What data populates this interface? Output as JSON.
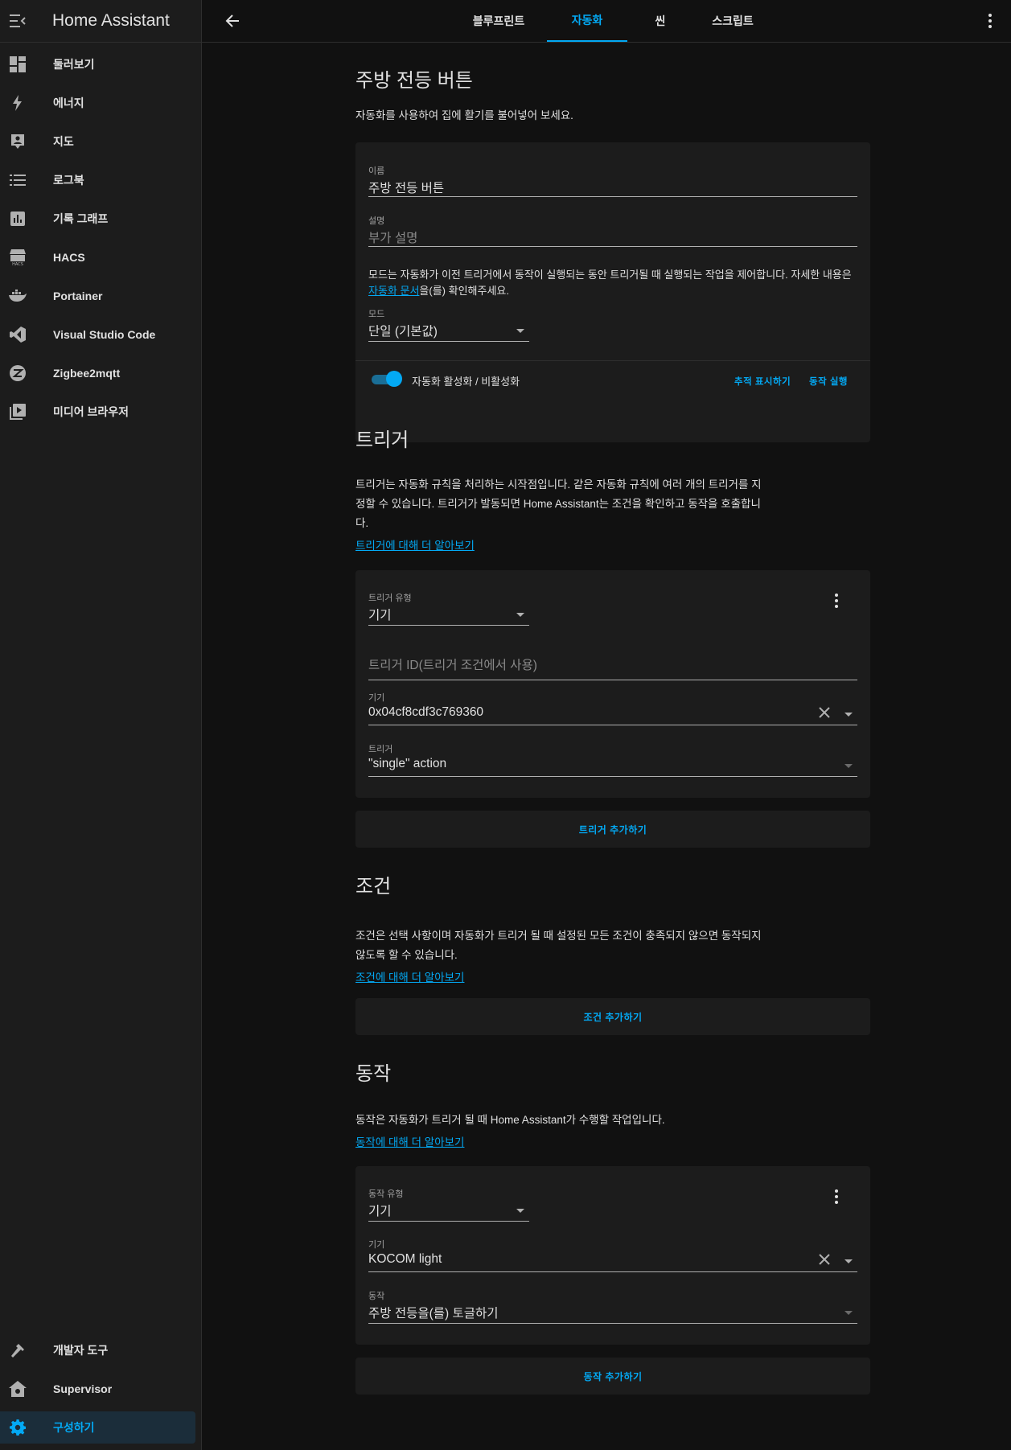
{
  "app": {
    "title": "Home Assistant"
  },
  "sidebar": {
    "items": [
      {
        "label": "둘러보기",
        "icon": "dashboard-icon"
      },
      {
        "label": "에너지",
        "icon": "lightning-icon"
      },
      {
        "label": "지도",
        "icon": "map-person-icon"
      },
      {
        "label": "로그북",
        "icon": "list-icon"
      },
      {
        "label": "기록 그래프",
        "icon": "chart-icon"
      },
      {
        "label": "HACS",
        "icon": "hacs-icon"
      },
      {
        "label": "Portainer",
        "icon": "docker-icon"
      },
      {
        "label": "Visual Studio Code",
        "icon": "vscode-icon"
      },
      {
        "label": "Zigbee2mqtt",
        "icon": "zigbee-icon"
      },
      {
        "label": "미디어 브라우저",
        "icon": "media-icon"
      }
    ],
    "bottom": [
      {
        "label": "개발자 도구",
        "icon": "hammer-icon"
      },
      {
        "label": "Supervisor",
        "icon": "supervisor-home-icon"
      },
      {
        "label": "구성하기",
        "icon": "gear-icon",
        "active": true
      }
    ]
  },
  "tabs": [
    {
      "label": "블루프린트"
    },
    {
      "label": "자동화",
      "active": true
    },
    {
      "label": "씬"
    },
    {
      "label": "스크립트"
    }
  ],
  "automation": {
    "heading": "주방 전등 버튼",
    "intro": "자동화를 사용하여 집에 활기를 불어넣어 보세요.",
    "name_label": "이름",
    "name_value": "주방 전등 버튼",
    "desc_label": "설명",
    "desc_placeholder": "부가 설명",
    "mode_help_1": "모드는 자동화가 이전 트리거에서 동작이 실행되는 동안 트리거될 때 실행되는 작업을 제어합니다. 자세한 내용은",
    "mode_help_link": "자동화 문서",
    "mode_help_2": "을(를) 확인해주세요.",
    "mode_label": "모드",
    "mode_value": "단일 (기본값)",
    "toggle_label": "자동화 활성화 / 비활성화",
    "toggle_on": true,
    "trace_button": "추적 표시하기",
    "run_button": "동작 실행"
  },
  "triggers": {
    "heading": "트리거",
    "desc_1": "트리거는 자동화 규칙을 처리하는 시작점입니다. 같은 자동화 규칙에 여러 개의 트리거를 지",
    "desc_2": "정할 수 있습니다. 트리거가 발동되면 Home Assistant는 조건을 확인하고 동작을 호출합니",
    "desc_3": "다.",
    "learn_more": "트리거에 대해 더 알아보기",
    "type_label": "트리거 유형",
    "type_value": "기기",
    "id_placeholder": "트리거 ID(트리거 조건에서 사용)",
    "device_label": "기기",
    "device_value": "0x04cf8cdf3c769360",
    "trigger_label": "트리거",
    "trigger_value": "\"single\" action",
    "add_button": "트리거 추가하기"
  },
  "conditions": {
    "heading": "조건",
    "desc_1": "조건은 선택 사항이며 자동화가 트리거 될 때 설정된 모든 조건이 충족되지 않으면 동작되지",
    "desc_2": "않도록 할 수 있습니다.",
    "learn_more": "조건에 대해 더 알아보기",
    "add_button": "조건 추가하기"
  },
  "actions": {
    "heading": "동작",
    "desc": "동작은 자동화가 트리거 될 때 Home Assistant가 수행할 작업입니다.",
    "learn_more": "동작에 대해 더 알아보기",
    "type_label": "동작 유형",
    "type_value": "기기",
    "device_label": "기기",
    "device_value": "KOCOM light",
    "action_label": "동작",
    "action_value": "주방 전등을(를) 토글하기",
    "add_button": "동작 추가하기"
  },
  "colors": {
    "accent": "#03a9f4",
    "background": "#111111",
    "card": "#1c1c1c",
    "text": "#e1e1e1"
  }
}
